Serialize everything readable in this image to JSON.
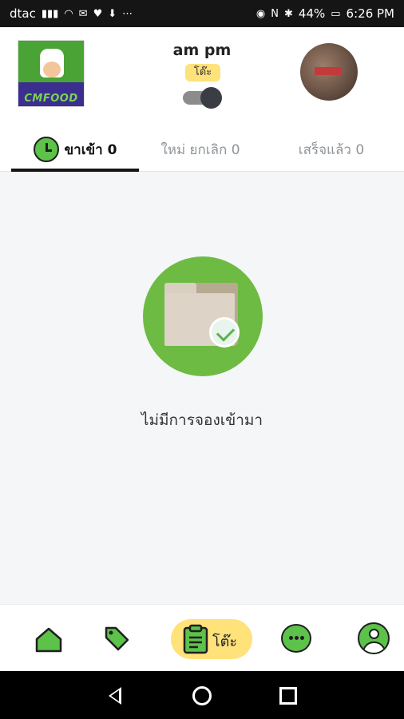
{
  "status_bar": {
    "carrier": "dtac",
    "battery": "44%",
    "time": "6:26 PM"
  },
  "header": {
    "logo_text": "CMFOOD",
    "title": "am pm",
    "table_chip": "โต๊ะ"
  },
  "tabs": [
    {
      "label": "ขาเข้า 0",
      "active": true
    },
    {
      "label": "ใหม่ ยกเลิก 0",
      "active": false
    },
    {
      "label": "เสร็จแล้ว 0",
      "active": false
    }
  ],
  "empty_state": {
    "message": "ไม่มีการจองเข้ามา"
  },
  "bottom_nav": {
    "active_label": "โต๊ะ"
  },
  "colors": {
    "accent_green": "#6dbb43",
    "chip_yellow": "#ffe27a"
  }
}
